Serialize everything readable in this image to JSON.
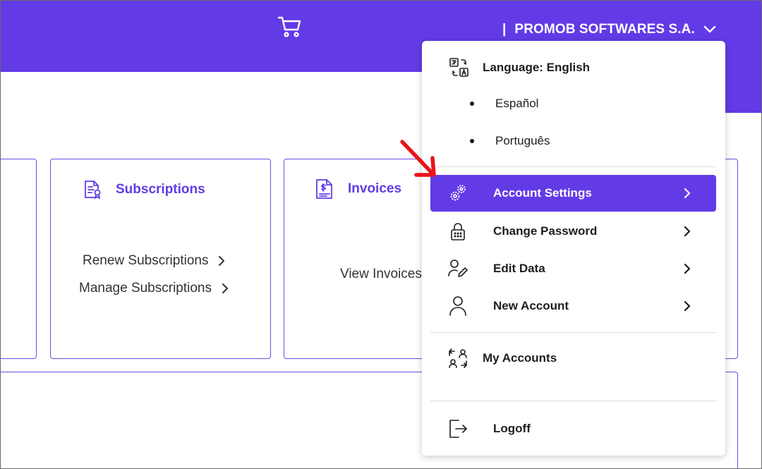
{
  "header": {
    "cart_icon": "shopping-cart-icon",
    "separator": "|",
    "company_name": "PROMOB SOFTWARES S.A.",
    "accent_color": "#623be6"
  },
  "cards": {
    "subscriptions": {
      "title": "Subscriptions",
      "icon": "certificate-document-icon",
      "links": [
        "Renew Subscriptions",
        "Manage Subscriptions"
      ]
    },
    "invoices": {
      "title": "Invoices",
      "icon": "invoice-dollar-icon",
      "links": [
        "View Invoices"
      ]
    }
  },
  "dropdown": {
    "language": {
      "label": "Language: English",
      "icon": "translate-icon",
      "options": [
        "Español",
        "Português"
      ]
    },
    "items": [
      {
        "label": "Account Settings",
        "icon": "gears-icon",
        "active": true
      },
      {
        "label": "Change Password",
        "icon": "lock-icon",
        "active": false
      },
      {
        "label": "Edit Data",
        "icon": "user-edit-icon",
        "active": false
      },
      {
        "label": "New Account",
        "icon": "user-icon",
        "active": false
      }
    ],
    "my_accounts": {
      "label": "My Accounts",
      "icon": "switch-accounts-icon"
    },
    "logoff": {
      "label": "Logoff",
      "icon": "logout-icon"
    }
  },
  "annotation": {
    "icon": "red-arrow-icon",
    "color": "#e8141b"
  }
}
